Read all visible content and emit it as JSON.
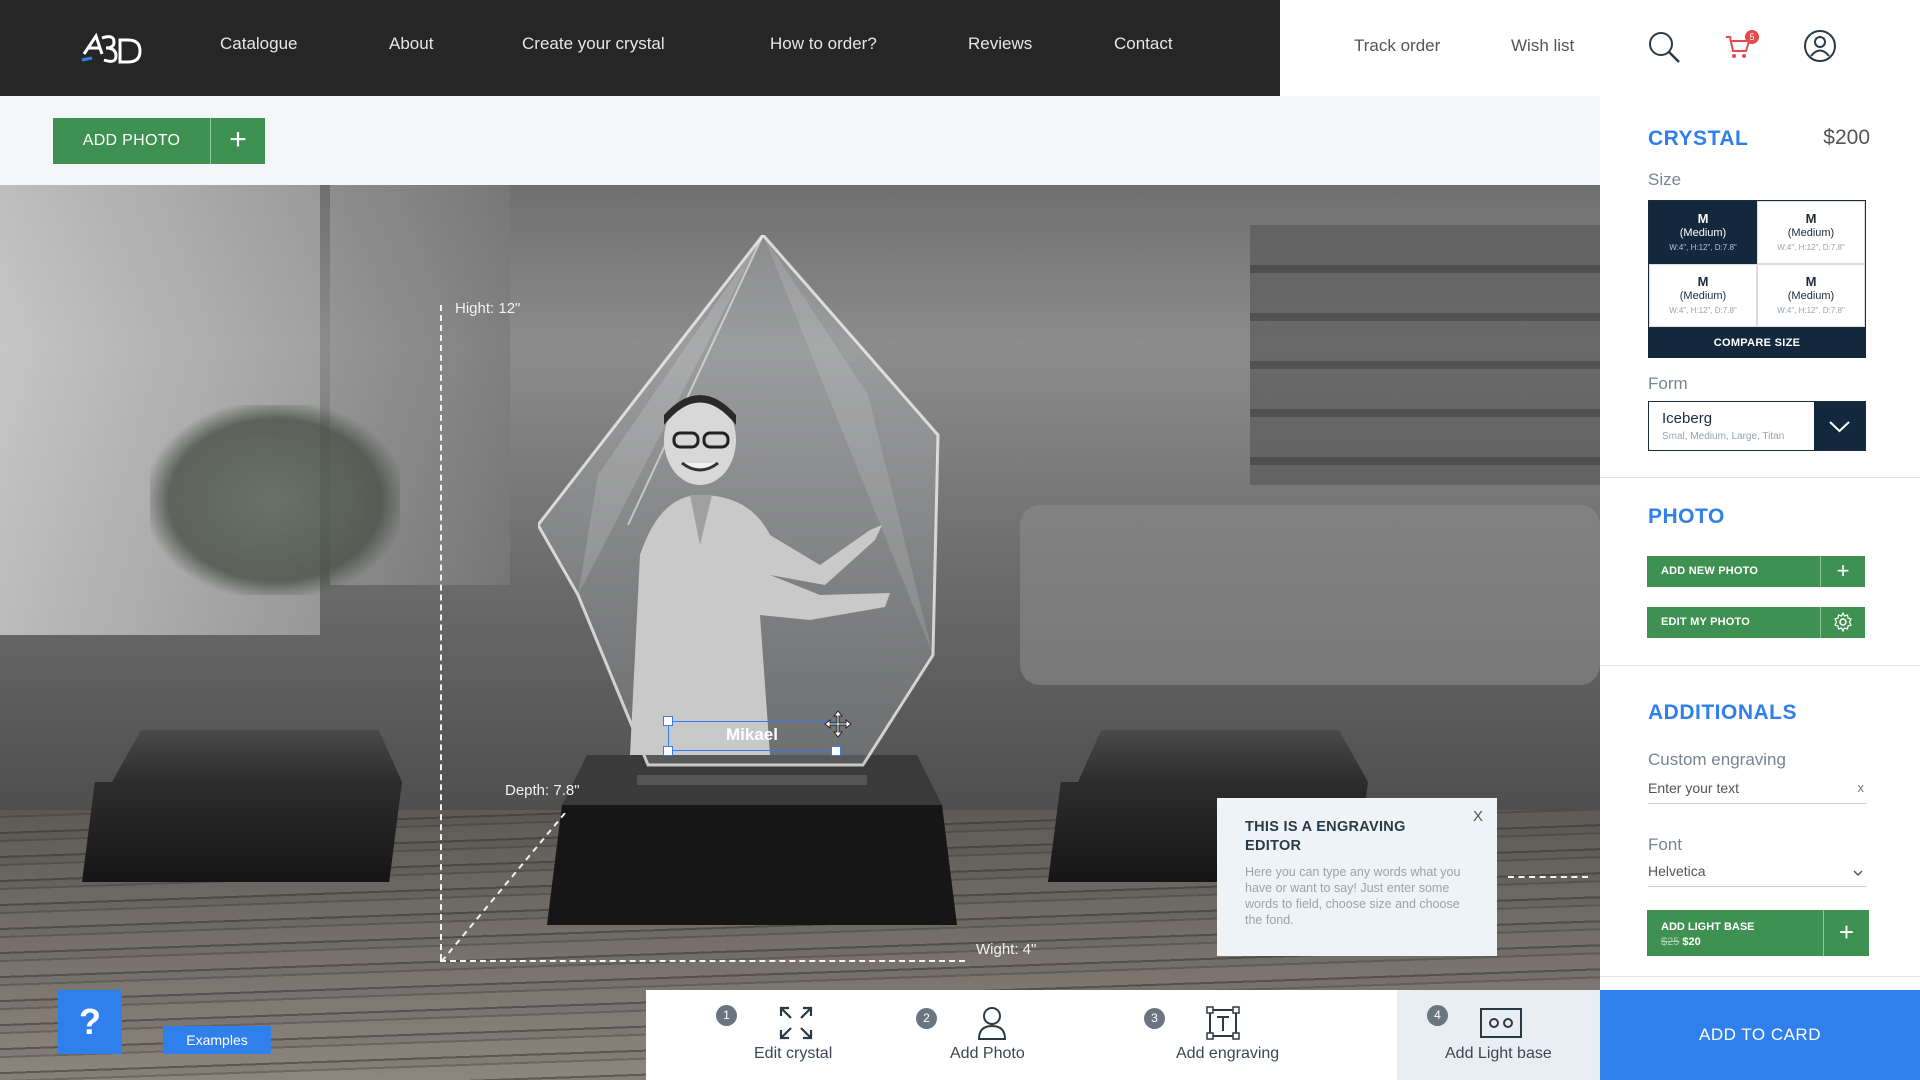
{
  "header": {
    "logo_text": "AR3D",
    "nav": [
      "Catalogue",
      "About",
      "Create your crystal",
      "How to order?",
      "Reviews",
      "Contact"
    ],
    "track_order": "Track order",
    "wish_list": "Wish list",
    "cart_count": "5",
    "icons": [
      "search-icon",
      "cart-icon",
      "user-icon"
    ]
  },
  "toolbar": {
    "add_photo_label": "ADD PHOTO",
    "add_photo_plus": "+"
  },
  "scene": {
    "height_label": "Hight: 12\"",
    "depth_label": "Depth: 7.8\"",
    "width_label": "Wight: 4\"",
    "engraving_text": "Mikael"
  },
  "tooltip": {
    "title": "THIS IS A ENGRAVING EDITOR",
    "body": "Here you can type any words what you have or want to say! Just enter some words to field, choose size and choose  the fond.",
    "close": "X"
  },
  "help": {
    "label": "?",
    "examples": "Examples"
  },
  "steps": [
    {
      "num": "1",
      "label": "Edit crystal",
      "icon": "expand-icon"
    },
    {
      "num": "2",
      "label": "Add Photo",
      "icon": "person-icon"
    },
    {
      "num": "3",
      "label": "Add engraving",
      "icon": "text-frame-icon"
    },
    {
      "num": "4",
      "label": "Add Light base",
      "icon": "light-base-icon"
    }
  ],
  "panel": {
    "crystal_title": "CRYSTAL",
    "price": "$200",
    "size_label": "Size",
    "sizes": [
      {
        "code": "M",
        "name": "(Medium)",
        "dims": "W:4\", H:12\", D:7.8\"",
        "selected": true
      },
      {
        "code": "M",
        "name": "(Medium)",
        "dims": "W:4\", H:12\", D:7.8\"",
        "selected": false
      },
      {
        "code": "M",
        "name": "(Medium)",
        "dims": "W:4\", H:12\", D:7.8\"",
        "selected": false
      },
      {
        "code": "M",
        "name": "(Medium)",
        "dims": "W:4\", H:12\", D:7.8\"",
        "selected": false
      }
    ],
    "compare_size": "COMPARE SIZE",
    "form_label": "Form",
    "form_value": "Iceberg",
    "form_sub": "Smal, Medium, Large, Titan",
    "photo_title": "PHOTO",
    "add_new_photo": "ADD NEW PHOTO",
    "edit_my_photo": "EDIT MY PHOTO",
    "additionals_title": "ADDITIONALS",
    "custom_engraving_label": "Custom engraving",
    "engraving_placeholder": "Enter your text",
    "engraving_clear": "x",
    "font_label": "Font",
    "font_value": "Helvetica",
    "light_base_label": "ADD LIGHT BASE",
    "light_base_old_price": "$25",
    "light_base_price": "$20",
    "add_to_card": "ADD TO CARD"
  },
  "colors": {
    "accent": "#2f80ed",
    "green": "#3f9152",
    "navy": "#13283c",
    "topbar": "#262626"
  }
}
